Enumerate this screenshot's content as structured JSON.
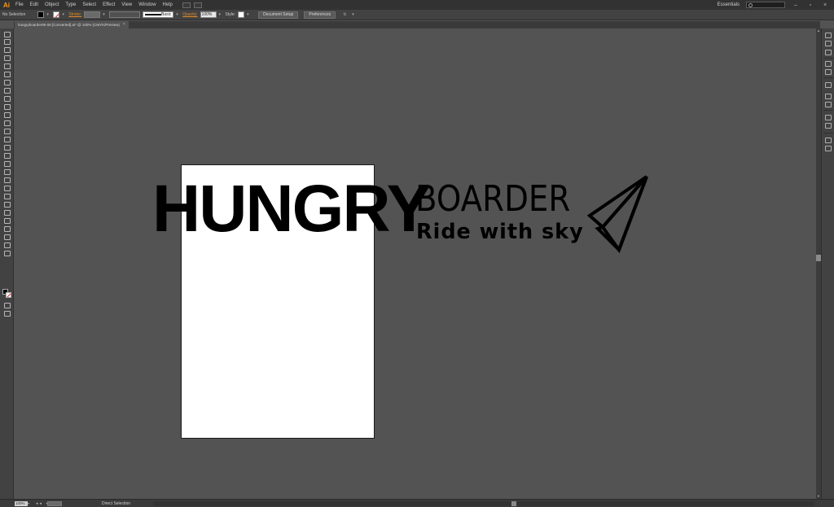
{
  "app": {
    "logo": "Ai"
  },
  "menu": {
    "items": [
      "File",
      "Edit",
      "Object",
      "Type",
      "Select",
      "Effect",
      "View",
      "Window",
      "Help"
    ],
    "workspace": "Essentials"
  },
  "control_bar": {
    "selection_label": "No Selection",
    "stroke_label": "Stroke:",
    "stroke_style": "Basic",
    "opacity_label": "Opacity:",
    "opacity_value": "100%",
    "style_label": "Style:",
    "document_setup": "Document Setup",
    "preferences": "Preferences"
  },
  "document": {
    "tab_title": "hungryboarder95-06 [Converted].ai* @ 100% (CMYK/Preview)"
  },
  "artwork": {
    "headline": "HUNGRY",
    "brand": "BOARDER",
    "tagline": "Ride with sky",
    "fill_color": "#000000",
    "artboard_color": "#ffffff",
    "canvas_color": "#535353"
  },
  "status_bar": {
    "zoom": "100%",
    "current_tool": "Direct Selection"
  },
  "colors": {
    "accent": "#f79a1f",
    "stroke_none": "#dd2222"
  }
}
